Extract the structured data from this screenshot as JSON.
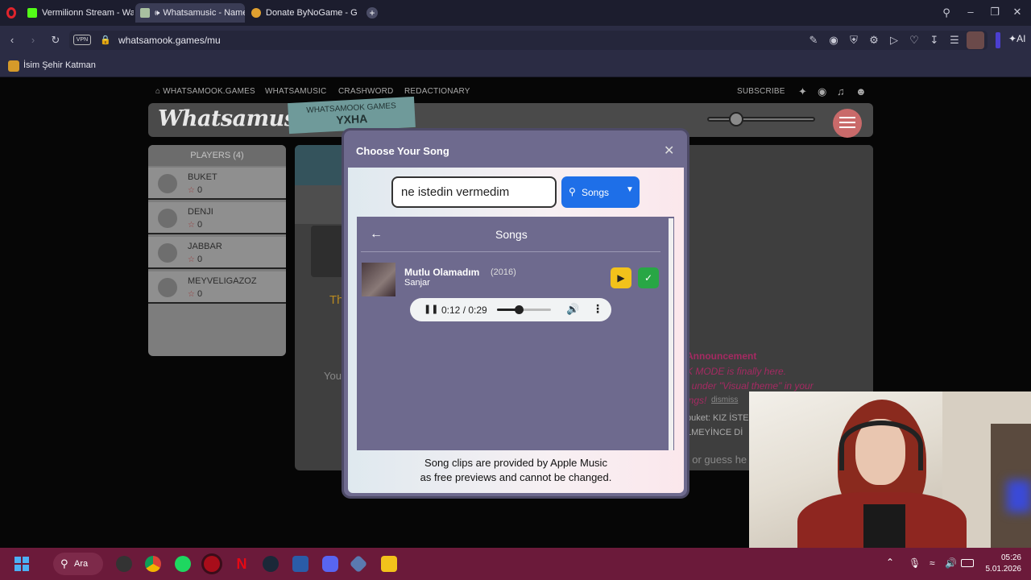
{
  "browser": {
    "tabs": [
      {
        "label": "Vermilionn Stream - Watc",
        "icon": "kick-icon",
        "color": "#53fc18"
      },
      {
        "label": "Whatsamusic - Name",
        "icon": "whatsamook-icon",
        "color": "#a8c0a0"
      },
      {
        "label": "Donate ByNoGame - Gele",
        "icon": "bynogame-icon",
        "color": "#e0a030"
      }
    ],
    "url": "whatsamook.games/mu",
    "vpn_label": "VPN",
    "ai_label": "AI",
    "bookmark": "İsim Şehir Katman"
  },
  "site": {
    "nav": [
      "WHATSAMOOK.GAMES",
      "WHATSAMUSIC",
      "CRASHWORD",
      "REDACTIONARY"
    ],
    "subscribe": "SUBSCRIBE",
    "logo": "Whatsamusic",
    "badge_line1": "WHATSAMOOK GAMES",
    "badge_line2": "YXHA",
    "players_title": "PLAYERS (4)",
    "players": [
      {
        "name": "BUKET",
        "score": "0"
      },
      {
        "name": "DENJI",
        "score": "0"
      },
      {
        "name": "JABBAR",
        "score": "0"
      },
      {
        "name": "MEYVELIGAZOZ",
        "score": "0"
      }
    ],
    "bg_fragment_th": "Th",
    "bg_fragment_you": "You",
    "announcement_title": "Announcement",
    "announcement_line1": "K MODE is finally here.",
    "announcement_line2": ": under \"Visual theme\" in your",
    "announcement_line3": "ings!",
    "dismiss": "dismiss",
    "chat_line1": "buket: KIZ İSTE",
    "chat_line2": "LMEYİNCE Dİ",
    "chat_input_fragment": "t or guess he"
  },
  "modal": {
    "title": "Choose Your Song",
    "search_value": "ne istedin vermedim",
    "songs_button": "Songs",
    "results_title": "Songs",
    "song": {
      "title": "Mutlu Olamadım",
      "year": "(2016)",
      "artist": "Sanjar"
    },
    "player": {
      "time": "0:12 / 0:29",
      "progress": 0.41
    },
    "footer_line1": "Song clips are provided by Apple Music",
    "footer_line2": "as free previews and cannot be changed."
  },
  "taskbar": {
    "search_label": "Ara",
    "time": "05:26",
    "date": "5.01.2026"
  },
  "colors": {
    "accent_blue": "#1e6fe8",
    "play_yellow": "#f2c21b",
    "check_green": "#28a745",
    "modal_purple": "#6e6a8e",
    "taskbar": "#6b1a3a"
  }
}
